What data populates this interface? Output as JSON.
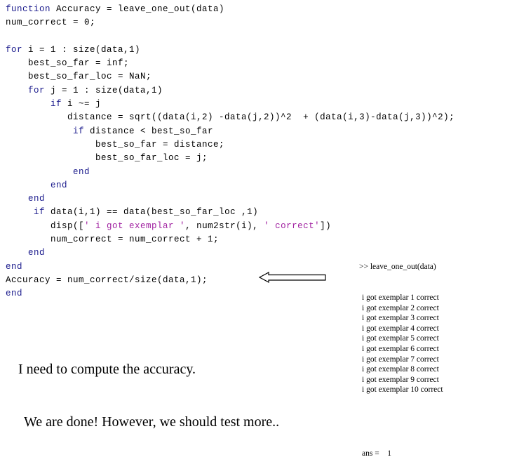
{
  "editor": {
    "language": "MATLAB",
    "colors": {
      "keyword": "#1a1a8c",
      "string": "#a020a0",
      "plain": "#000000",
      "background": "#ffffff"
    },
    "code_lines": [
      [
        {
          "t": "function",
          "c": "kw"
        },
        {
          "t": " Accuracy = leave_one_out(data)",
          "c": "pln"
        }
      ],
      [
        {
          "t": "num_correct = 0;",
          "c": "pln"
        }
      ],
      [
        {
          "t": "",
          "c": "pln"
        }
      ],
      [
        {
          "t": "for",
          "c": "kw"
        },
        {
          "t": " i = 1 : size(data,1)",
          "c": "pln"
        }
      ],
      [
        {
          "t": "    best_so_far = inf;",
          "c": "pln"
        }
      ],
      [
        {
          "t": "    best_so_far_loc = NaN;",
          "c": "pln"
        }
      ],
      [
        {
          "t": "    ",
          "c": "pln"
        },
        {
          "t": "for",
          "c": "kw"
        },
        {
          "t": " j = 1 : size(data,1)",
          "c": "pln"
        }
      ],
      [
        {
          "t": "        ",
          "c": "pln"
        },
        {
          "t": "if",
          "c": "kw"
        },
        {
          "t": " i ~= j",
          "c": "pln"
        }
      ],
      [
        {
          "t": "           distance = sqrt((data(i,2) -data(j,2))^2  + (data(i,3)-data(j,3))^2);",
          "c": "pln"
        }
      ],
      [
        {
          "t": "            ",
          "c": "pln"
        },
        {
          "t": "if",
          "c": "kw"
        },
        {
          "t": " distance < best_so_far",
          "c": "pln"
        }
      ],
      [
        {
          "t": "                best_so_far = distance;",
          "c": "pln"
        }
      ],
      [
        {
          "t": "                best_so_far_loc = j;",
          "c": "pln"
        }
      ],
      [
        {
          "t": "            ",
          "c": "pln"
        },
        {
          "t": "end",
          "c": "kw"
        }
      ],
      [
        {
          "t": "        ",
          "c": "pln"
        },
        {
          "t": "end",
          "c": "kw"
        }
      ],
      [
        {
          "t": "    ",
          "c": "pln"
        },
        {
          "t": "end",
          "c": "kw"
        }
      ],
      [
        {
          "t": "     ",
          "c": "pln"
        },
        {
          "t": "if",
          "c": "kw"
        },
        {
          "t": " data(i,1) == data(best_so_far_loc ,1)",
          "c": "pln"
        }
      ],
      [
        {
          "t": "        disp([",
          "c": "pln"
        },
        {
          "t": "' i got exemplar '",
          "c": "str"
        },
        {
          "t": ", num2str(i), ",
          "c": "pln"
        },
        {
          "t": "' correct'",
          "c": "str"
        },
        {
          "t": "])",
          "c": "pln"
        }
      ],
      [
        {
          "t": "        num_correct = num_correct + 1;",
          "c": "pln"
        }
      ],
      [
        {
          "t": "    ",
          "c": "pln"
        },
        {
          "t": "end",
          "c": "kw"
        }
      ],
      [
        {
          "t": "end",
          "c": "kw"
        }
      ],
      [
        {
          "t": "Accuracy = num_correct/size(data,1);",
          "c": "pln"
        }
      ],
      [
        {
          "t": "end",
          "c": "kw"
        }
      ]
    ]
  },
  "arrow": {
    "direction": "left",
    "style": "hollow-block-arrow",
    "color": "#000000"
  },
  "annotation": {
    "line1": "I need to compute the accuracy.",
    "line2": "We are done! However, we should test more.."
  },
  "console": {
    "prompt": ">> leave_one_out(data)",
    "output_lines": [
      "i got exemplar 1 correct",
      "i got exemplar 2 correct",
      "i got exemplar 3 correct",
      "i got exemplar 4 correct",
      "i got exemplar 5 correct",
      "i got exemplar 6 correct",
      "i got exemplar 7 correct",
      "i got exemplar 8 correct",
      "i got exemplar 9 correct",
      "i got exemplar 10 correct"
    ],
    "ans_label": "ans =",
    "ans_value": "1"
  }
}
